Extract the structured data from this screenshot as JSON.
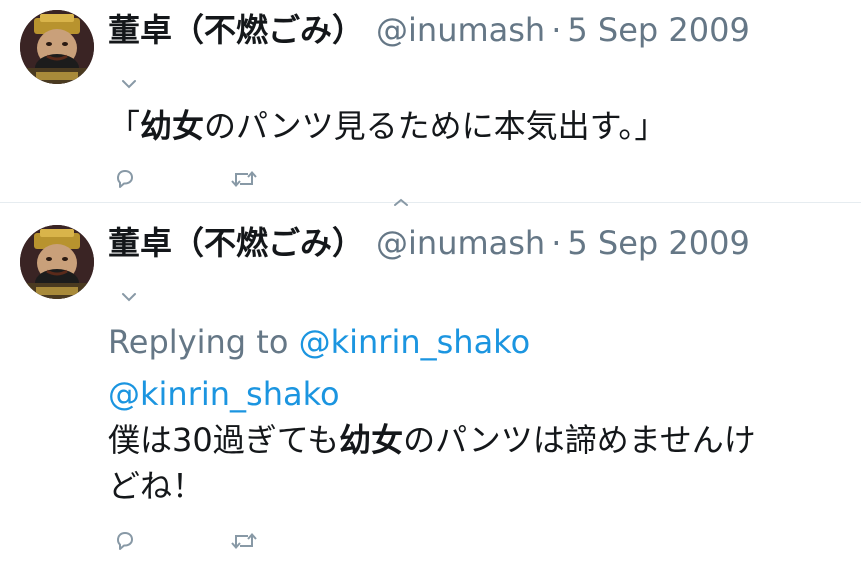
{
  "tweets": [
    {
      "name": "董卓（不燃ごみ）",
      "handle": "@inumash",
      "separator": "·",
      "date": "5 Sep 2009",
      "text_pre": "「",
      "text_bold": "幼女",
      "text_post": "のパンツ見るために本気出す。」"
    },
    {
      "name": "董卓（不燃ごみ）",
      "handle": "@inumash",
      "separator": "·",
      "date": "5 Sep 2009",
      "replying_label": "Replying to",
      "replying_handle": "@kinrin_shako",
      "mention": "@kinrin_shako",
      "text_pre": "僕は30過ぎても",
      "text_bold": "幼女",
      "text_post": "のパンツは諦めませんけ",
      "text_line2": "どね！"
    }
  ],
  "icons": {
    "reply": "reply-icon",
    "retweet": "retweet-icon",
    "caret": "chevron-down-icon",
    "expand": "expand-icon"
  },
  "colors": {
    "text": "#14171a",
    "muted": "#657786",
    "link": "#1b95e0",
    "divider": "#e6ecf0",
    "icon": "#8899a6"
  }
}
